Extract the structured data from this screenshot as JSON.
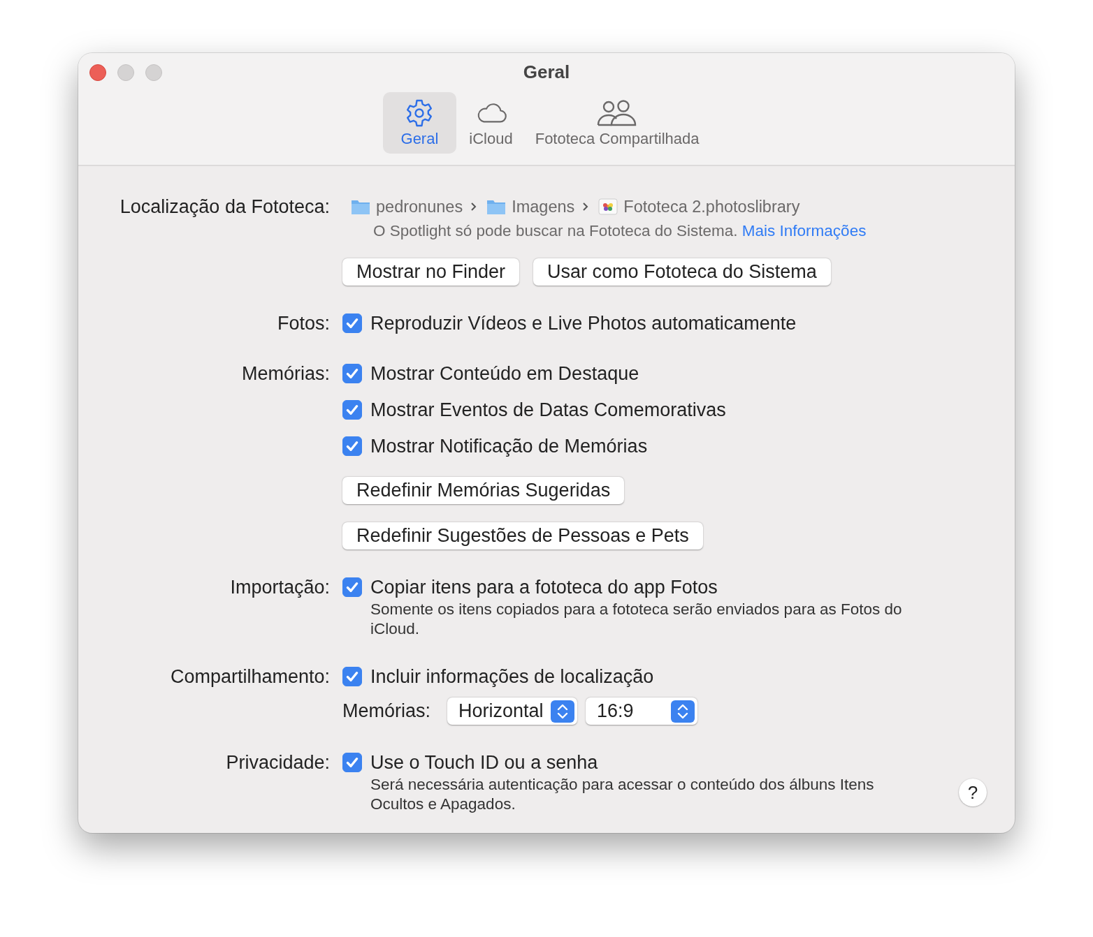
{
  "window": {
    "title": "Geral"
  },
  "tabs": [
    {
      "label": "Geral",
      "selected": true
    },
    {
      "label": "iCloud",
      "selected": false
    },
    {
      "label": "Fototeca Compartilhada",
      "selected": false
    }
  ],
  "sections": [
    {
      "label": "Localização da Fototeca:",
      "items": [
        {
          "kind": "path",
          "segments": [
            "pedronunes",
            "Imagens",
            "Fototeca 2.photoslibrary"
          ]
        },
        {
          "kind": "note",
          "text": "O Spotlight só pode buscar na Fototeca do Sistema.",
          "link": "Mais Informações"
        },
        {
          "kind": "buttons",
          "buttons": [
            "Mostrar no Finder",
            "Usar como Fototeca do Sistema"
          ]
        }
      ]
    },
    {
      "label": "Fotos:",
      "items": [
        {
          "kind": "checkbox",
          "label": "Reproduzir Vídeos e Live Photos automaticamente",
          "checked": true
        }
      ]
    },
    {
      "label": "Memórias:",
      "items": [
        {
          "kind": "checkbox",
          "label": "Mostrar Conteúdo em Destaque",
          "checked": true
        },
        {
          "kind": "checkbox",
          "label": "Mostrar Eventos de Datas Comemorativas",
          "checked": true
        },
        {
          "kind": "checkbox",
          "label": "Mostrar Notificação de Memórias",
          "checked": true
        },
        {
          "kind": "buttons",
          "buttons": [
            "Redefinir Memórias Sugeridas"
          ]
        },
        {
          "kind": "buttons",
          "buttons": [
            "Redefinir Sugestões de Pessoas e Pets"
          ]
        }
      ]
    },
    {
      "label": "Importação:",
      "items": [
        {
          "kind": "checkbox",
          "label": "Copiar itens para a fototeca do app Fotos",
          "checked": true,
          "note": "Somente os itens copiados para a fototeca serão enviados para as Fotos do iCloud."
        }
      ]
    },
    {
      "label": "Compartilhamento:",
      "items": [
        {
          "kind": "checkbox",
          "label": "Incluir informações de localização",
          "checked": true
        },
        {
          "kind": "selects",
          "label": "Memórias:",
          "selects": [
            "Horizontal",
            "16:9"
          ]
        }
      ]
    },
    {
      "label": "Privacidade:",
      "items": [
        {
          "kind": "checkbox",
          "label": "Use o Touch ID ou a senha",
          "checked": true,
          "note": "Será necessária autenticação para acessar o conteúdo dos álbuns Itens Ocultos e Apagados."
        }
      ]
    }
  ],
  "help": "?"
}
